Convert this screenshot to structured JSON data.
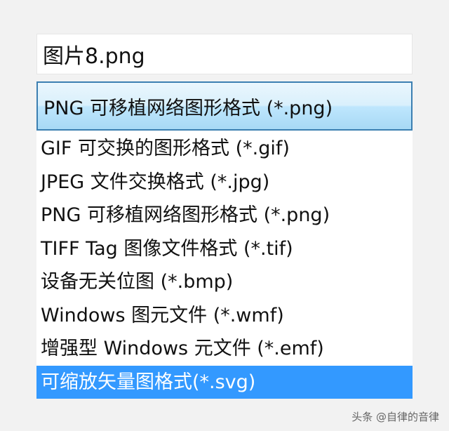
{
  "file_name": {
    "value": "图片8.png"
  },
  "save_type": {
    "selected": "PNG 可移植网络图形格式 (*.png)",
    "options": [
      {
        "label": "GIF 可交换的图形格式 (*.gif)"
      },
      {
        "label": "JPEG 文件交换格式 (*.jpg)"
      },
      {
        "label": "PNG 可移植网络图形格式 (*.png)"
      },
      {
        "label": "TIFF Tag 图像文件格式 (*.tif)"
      },
      {
        "label": "设备无关位图 (*.bmp)"
      },
      {
        "label": "Windows 图元文件 (*.wmf)"
      },
      {
        "label": "增强型 Windows 元文件 (*.emf)"
      },
      {
        "label": "可缩放矢量图格式(*.svg)"
      }
    ],
    "highlighted_index": 7
  },
  "watermark": {
    "text": "头条 @自律的音律"
  },
  "colors": {
    "highlight": "#3399ff",
    "select_border": "#3c7fb1"
  }
}
